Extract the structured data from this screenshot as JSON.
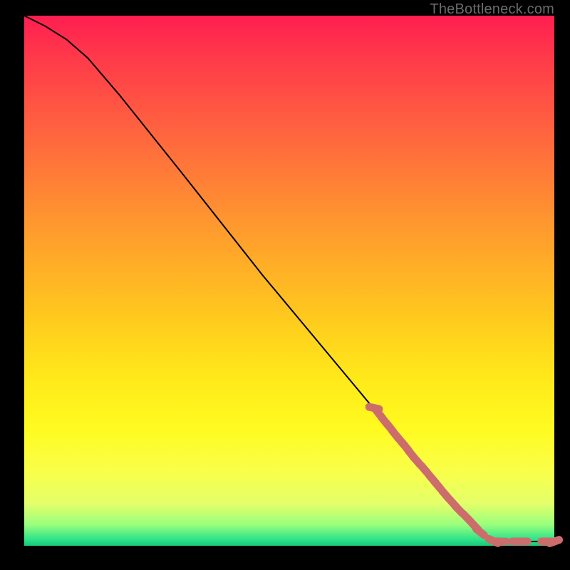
{
  "watermark": "TheBottleneck.com",
  "colors": {
    "curve_stroke": "#000000",
    "marker_fill": "#cc6d6c",
    "marker_stroke": "#cc6d6c"
  },
  "chart_data": {
    "type": "line",
    "title": "",
    "xlabel": "",
    "ylabel": "",
    "xlim": [
      0,
      100
    ],
    "ylim": [
      0,
      100
    ],
    "curve": [
      {
        "x": 0,
        "y": 100
      },
      {
        "x": 4,
        "y": 98
      },
      {
        "x": 8,
        "y": 95.5
      },
      {
        "x": 12,
        "y": 92
      },
      {
        "x": 18,
        "y": 85
      },
      {
        "x": 30,
        "y": 70
      },
      {
        "x": 45,
        "y": 51
      },
      {
        "x": 60,
        "y": 33
      },
      {
        "x": 70,
        "y": 21
      },
      {
        "x": 80,
        "y": 9
      },
      {
        "x": 86,
        "y": 2.5
      },
      {
        "x": 88,
        "y": 1.2
      },
      {
        "x": 90,
        "y": 0.8
      },
      {
        "x": 94,
        "y": 0.8
      },
      {
        "x": 100,
        "y": 0.8
      }
    ],
    "markers": [
      {
        "x": 66,
        "y": 26.0
      },
      {
        "x": 67,
        "y": 24.8
      },
      {
        "x": 68,
        "y": 23.5
      },
      {
        "x": 69,
        "y": 22.3
      },
      {
        "x": 70,
        "y": 21.0
      },
      {
        "x": 71,
        "y": 19.8
      },
      {
        "x": 72,
        "y": 18.6
      },
      {
        "x": 73,
        "y": 17.3
      },
      {
        "x": 74,
        "y": 16.1
      },
      {
        "x": 75.5,
        "y": 14.4
      },
      {
        "x": 77,
        "y": 12.6
      },
      {
        "x": 78,
        "y": 11.4
      },
      {
        "x": 79.5,
        "y": 9.6
      },
      {
        "x": 81,
        "y": 7.9
      },
      {
        "x": 82,
        "y": 6.8
      },
      {
        "x": 83.5,
        "y": 5.3
      },
      {
        "x": 85,
        "y": 3.7
      },
      {
        "x": 86,
        "y": 2.6
      },
      {
        "x": 88.5,
        "y": 0.9
      },
      {
        "x": 90,
        "y": 0.8
      },
      {
        "x": 93,
        "y": 0.8
      },
      {
        "x": 94,
        "y": 0.8
      },
      {
        "x": 98.5,
        "y": 0.8
      },
      {
        "x": 100,
        "y": 0.8
      }
    ]
  }
}
